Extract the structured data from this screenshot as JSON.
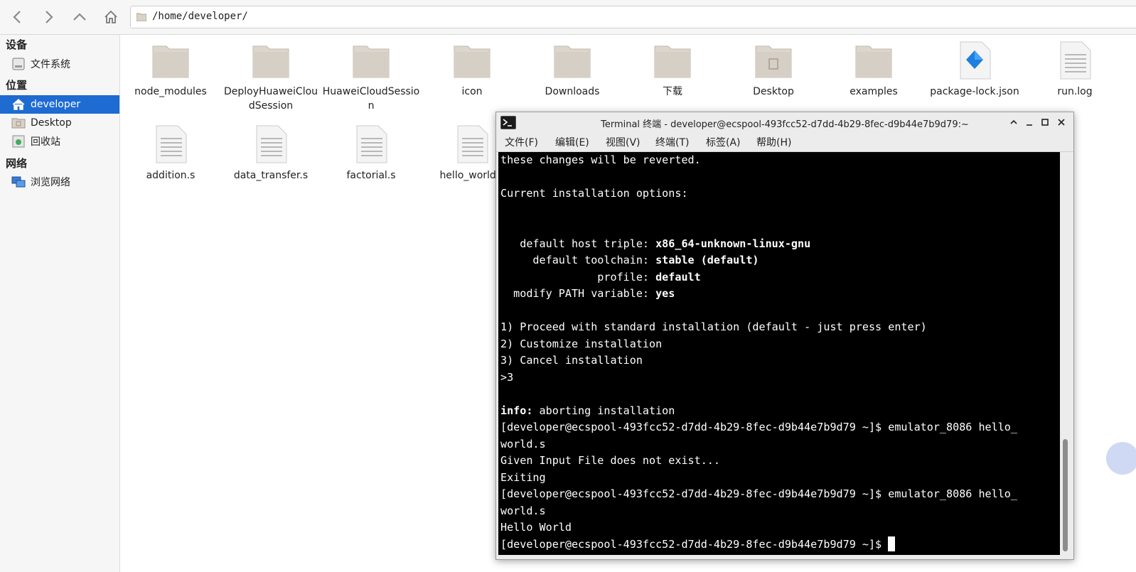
{
  "toolbar": {
    "path": "/home/developer/"
  },
  "sidebar": {
    "sections": [
      {
        "title": "设备"
      },
      {
        "title": "位置"
      },
      {
        "title": "网络"
      }
    ],
    "items": [
      {
        "label": "文件系统",
        "icon": "drive-icon"
      },
      {
        "label": "developer",
        "icon": "home-icon",
        "active": true
      },
      {
        "label": "Desktop",
        "icon": "desktop-folder-icon"
      },
      {
        "label": "回收站",
        "icon": "trash-icon"
      },
      {
        "label": "浏览网络",
        "icon": "network-icon"
      }
    ]
  },
  "files": [
    {
      "name": "node_modules",
      "type": "folder"
    },
    {
      "name": "DeployHuaweiCloudSession",
      "type": "folder"
    },
    {
      "name": "HuaweiCloudSession",
      "type": "folder"
    },
    {
      "name": "icon",
      "type": "folder"
    },
    {
      "name": "Downloads",
      "type": "folder"
    },
    {
      "name": "下载",
      "type": "folder"
    },
    {
      "name": "Desktop",
      "type": "desktop-folder"
    },
    {
      "name": "examples",
      "type": "folder"
    },
    {
      "name": "package-lock.json",
      "type": "json"
    },
    {
      "name": "run.log",
      "type": "text"
    },
    {
      "name": "addition.s",
      "type": "text"
    },
    {
      "name": "data_transfer.s",
      "type": "text"
    },
    {
      "name": "factorial.s",
      "type": "text"
    },
    {
      "name": "hello_world.s",
      "type": "text"
    }
  ],
  "terminal": {
    "title": "Terminal 终端 - developer@ecspool-493fcc52-d7dd-4b29-8fec-d9b44e7b9d79:~",
    "menu": [
      "文件(F)",
      "编辑(E)",
      "视图(V)",
      "终端(T)",
      "标签(A)",
      "帮助(H)"
    ],
    "lines": [
      "these changes will be reverted.",
      "",
      "Current installation options:",
      "",
      "",
      "   default host triple: x86_64-unknown-linux-gnu",
      "     default toolchain: stable (default)",
      "               profile: default",
      "  modify PATH variable: yes",
      "",
      "1) Proceed with standard installation (default - just press enter)",
      "2) Customize installation",
      "3) Cancel installation",
      ">3",
      "",
      "info: aborting installation",
      "[developer@ecspool-493fcc52-d7dd-4b29-8fec-d9b44e7b9d79 ~]$ emulator_8086 hello_",
      "world.s",
      "Given Input File does not exist...",
      "Exiting",
      "[developer@ecspool-493fcc52-d7dd-4b29-8fec-d9b44e7b9d79 ~]$ emulator_8086 hello_",
      "world.s",
      "Hello World",
      "[developer@ecspool-493fcc52-d7dd-4b29-8fec-d9b44e7b9d79 ~]$ "
    ]
  },
  "colors": {
    "selection": "#1e6bd1",
    "folder": "#dcd6cf",
    "terminal_bg": "#000000"
  }
}
